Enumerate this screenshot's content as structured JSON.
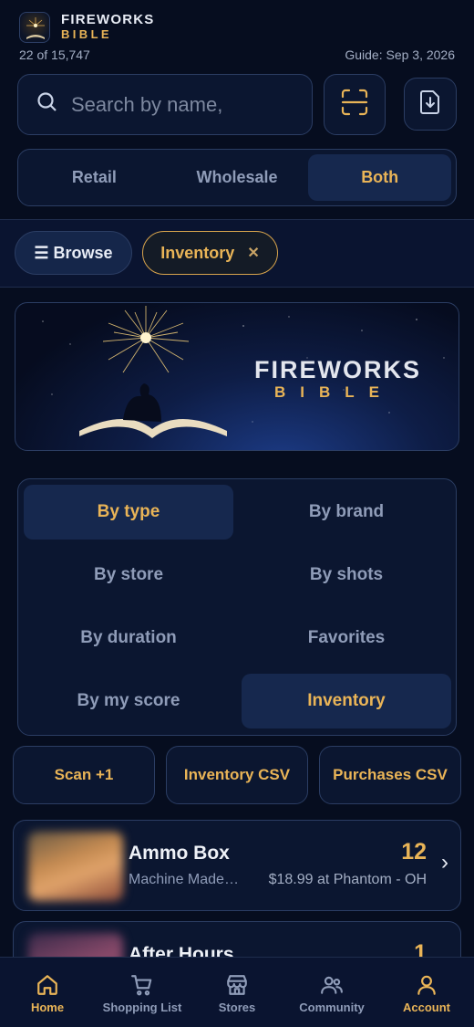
{
  "app": {
    "name_line1": "FIREWORKS",
    "name_line2": "BIBLE",
    "count": "22 of 15,747",
    "guide": "Guide: Sep 3, 2026"
  },
  "search": {
    "placeholder": "Search by name,"
  },
  "price_mode": {
    "options": [
      "Retail",
      "Wholesale",
      "Both"
    ],
    "selected": "Both"
  },
  "filters": {
    "browse": "☰ Browse",
    "chip": "Inventory",
    "chip_close": "✕"
  },
  "banner": {
    "title": "FIREWORKS",
    "subtitle": "BIBLE"
  },
  "categories": {
    "items": [
      "By type",
      "By brand",
      "By store",
      "By shots",
      "By duration",
      "Favorites",
      "By my score",
      "Inventory"
    ],
    "active": [
      "By type",
      "Inventory"
    ]
  },
  "actions": [
    "Scan +1",
    "Inventory CSV",
    "Purchases CSV"
  ],
  "items": [
    {
      "name": "Ammo Box",
      "brand": "Machine Made…",
      "qty": "12",
      "price": "$18.99 at Phantom - OH",
      "chevron": "›"
    },
    {
      "name": "After Hours",
      "qty": "1"
    }
  ],
  "tabs": [
    {
      "label": "Home",
      "icon": "home-icon",
      "active": true
    },
    {
      "label": "Shopping List",
      "icon": "cart-icon",
      "active": false
    },
    {
      "label": "Stores",
      "icon": "store-icon",
      "active": false
    },
    {
      "label": "Community",
      "icon": "community-icon",
      "active": false
    },
    {
      "label": "Account",
      "icon": "account-icon",
      "active": true
    }
  ],
  "colors": {
    "background": "#060d1f",
    "accent": "#e9b457",
    "panel": "#0b1630",
    "border": "#2b3d63"
  }
}
